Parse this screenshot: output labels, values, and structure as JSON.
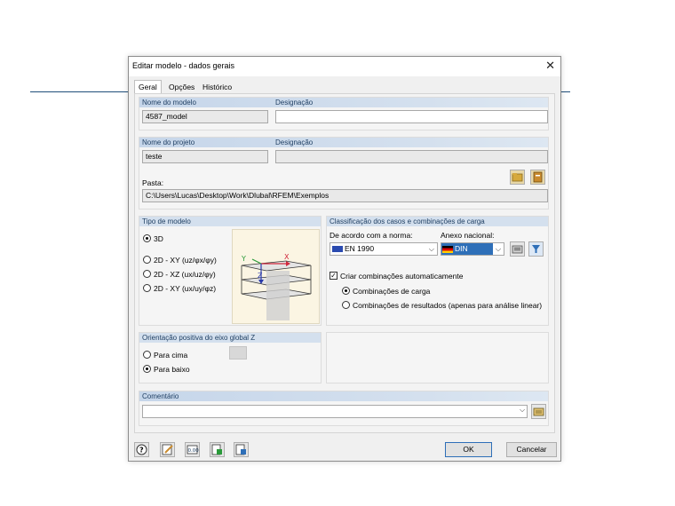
{
  "dialog": {
    "title": "Editar modelo - dados gerais",
    "close": "✕",
    "tabs": [
      {
        "label": "Geral",
        "active": true
      },
      {
        "label": "Opções",
        "active": false
      },
      {
        "label": "Histórico",
        "active": false
      }
    ]
  },
  "model": {
    "name_header": "Nome do modelo",
    "designation_header": "Designação",
    "name_value": "4587_model",
    "designation_value": ""
  },
  "project": {
    "name_header": "Nome do projeto",
    "designation_header": "Designação",
    "name_value": "teste",
    "designation_value": "",
    "folder_label": "Pasta:",
    "folder_value": "C:\\Users\\Lucas\\Desktop\\Work\\Dlubal\\RFEM\\Exemplos"
  },
  "model_type": {
    "header": "Tipo de modelo",
    "options": [
      {
        "label": "3D",
        "selected": true
      },
      {
        "label": "2D - XY (uz/φx/φy)",
        "selected": false
      },
      {
        "label": "2D - XZ (ux/uz/φy)",
        "selected": false
      },
      {
        "label": "2D - XY (ux/uy/φz)",
        "selected": false
      }
    ]
  },
  "classification": {
    "header": "Classificação dos casos e combinações de carga",
    "standard_label": "De acordo com a norma:",
    "annex_label": "Anexo nacional:",
    "standard_value": "EN 1990",
    "annex_value": "DIN",
    "auto_combinations_label": "Criar combinações automaticamente",
    "auto_combinations_checked": true,
    "combination_options": [
      {
        "label": "Combinações de carga",
        "selected": true
      },
      {
        "label": "Combinações de resultados (apenas para análise linear)",
        "selected": false
      }
    ]
  },
  "orientation": {
    "header": "Orientação positiva do eixo global Z",
    "options": [
      {
        "label": "Para cima",
        "selected": false
      },
      {
        "label": "Para baixo",
        "selected": true
      }
    ]
  },
  "comment": {
    "header": "Comentário",
    "value": ""
  },
  "footer": {
    "ok_label": "OK",
    "cancel_label": "Cancelar"
  },
  "colors": {
    "header_bg": "#d4e0ee",
    "header_text": "#1f3f63",
    "accent": "#2e6fb8"
  }
}
